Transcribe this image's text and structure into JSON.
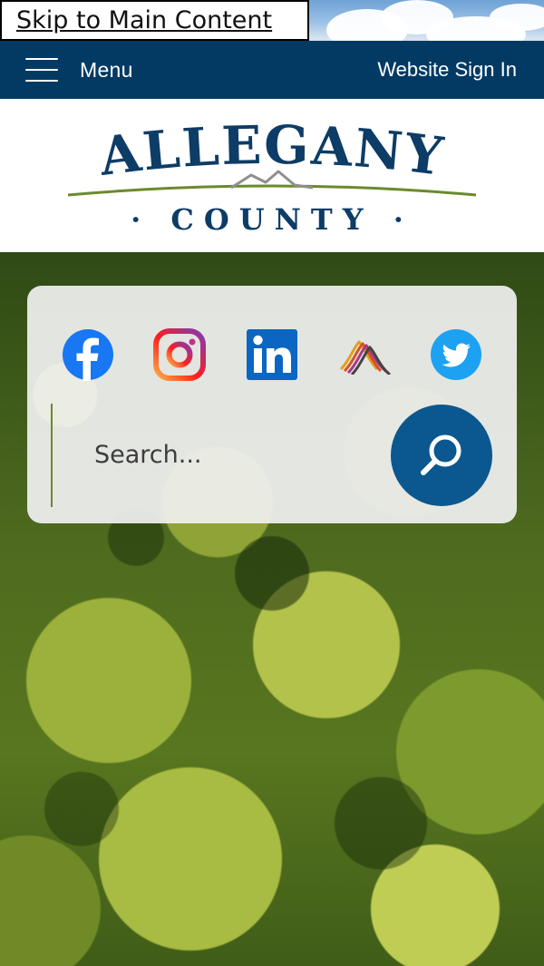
{
  "skip_link": {
    "label": "Skip to Main Content"
  },
  "navbar": {
    "menu_label": "Menu",
    "sign_in_label": "Website Sign In",
    "color": "#023a63"
  },
  "logo": {
    "top_text": "ALLEGANY",
    "bottom_text": "· COUNTY ·",
    "primary_color": "#0d3c66",
    "accent_color": "#6b8a2c"
  },
  "social": [
    {
      "name": "facebook",
      "icon": "facebook-icon"
    },
    {
      "name": "instagram",
      "icon": "instagram-icon"
    },
    {
      "name": "linkedin",
      "icon": "linkedin-icon"
    },
    {
      "name": "county-network",
      "icon": "network-icon"
    },
    {
      "name": "twitter",
      "icon": "twitter-icon"
    }
  ],
  "search": {
    "placeholder": "Search...",
    "value": "",
    "button_icon": "search-icon"
  }
}
